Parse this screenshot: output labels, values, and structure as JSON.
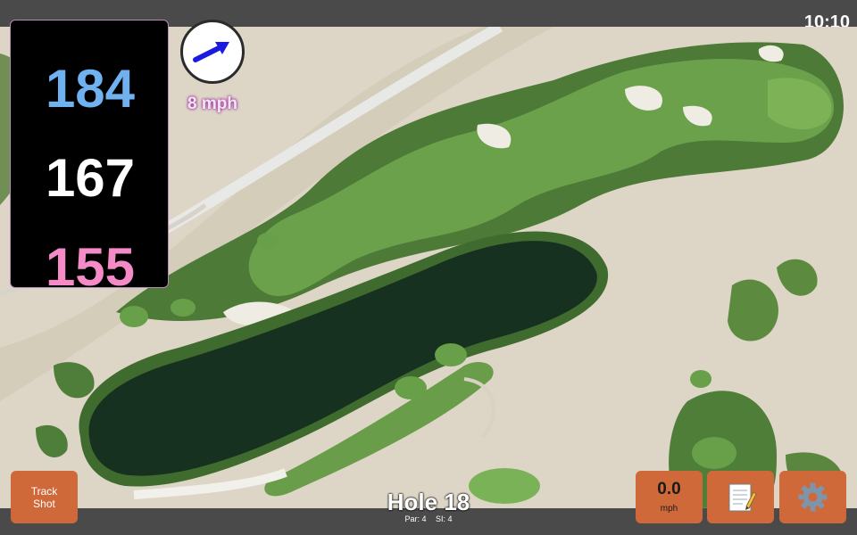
{
  "status": {
    "time": "10:10"
  },
  "distances": {
    "back": "184",
    "middle": "167",
    "front": "155"
  },
  "wind": {
    "speed": "8 mph",
    "direction_icon": "wind-arrow"
  },
  "hole": {
    "title": "Hole 18",
    "par": "Par: 4",
    "stroke_index": "SI: 4"
  },
  "buttons": {
    "track_shot": "Track\nShot",
    "speed_value": "0.0",
    "speed_unit": "mph",
    "notes_icon": "notepad-icon",
    "settings_icon": "gear-icon"
  },
  "colors": {
    "back_distance": "#6fb2ef",
    "middle_distance": "#ffffff",
    "front_distance": "#f58bc6",
    "button_bg": "#d0693a",
    "bar_bg": "#4a4a4a"
  }
}
